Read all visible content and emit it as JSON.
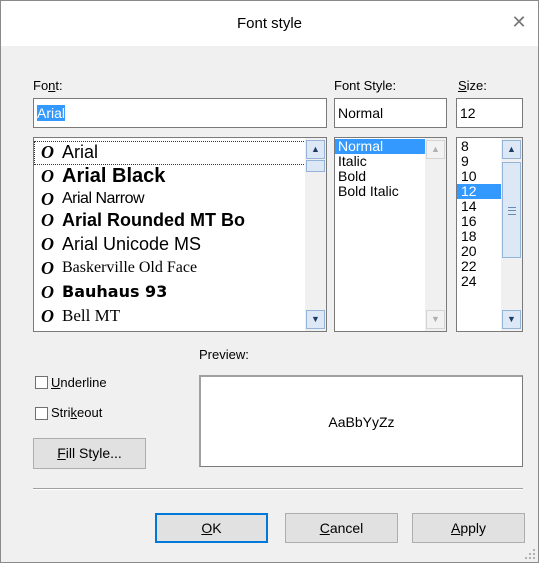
{
  "window": {
    "title": "Font style",
    "close_label": "✕"
  },
  "labels": {
    "font_pre": "Fo",
    "font_u": "n",
    "font_post": "t:",
    "style": "Font Style:",
    "size_u": "S",
    "size_post": "ize:",
    "preview": "Preview:"
  },
  "inputs": {
    "font": "Arial",
    "style": "Normal",
    "size": "12"
  },
  "font_list": [
    "Arial",
    "Arial Black",
    "Arial Narrow",
    "Arial Rounded MT Bo",
    "Arial Unicode MS",
    "Baskerville Old Face",
    "Bauhaus 93",
    "Bell MT"
  ],
  "font_icon_glyph": "O",
  "style_list": [
    "Normal",
    "Italic",
    "Bold",
    "Bold Italic"
  ],
  "size_list": [
    "8",
    "9",
    "10",
    "12",
    "14",
    "16",
    "18",
    "20",
    "22",
    "24"
  ],
  "options": {
    "underline_u": "U",
    "underline_post": "nderline",
    "strike_pre": "Stri",
    "strike_u": "k",
    "strike_post": "eout",
    "fill_u": "F",
    "fill_post": "ill Style..."
  },
  "preview_text": "AaBbYyZz",
  "buttons": {
    "ok_u": "O",
    "ok_post": "K",
    "cancel_u": "C",
    "cancel_post": "ancel",
    "apply_u": "A",
    "apply_post": "pply"
  },
  "scroll_glyphs": {
    "up": "▲",
    "down": "▼"
  },
  "colors": {
    "selection": "#3399ff",
    "scroll_accent": "#dce8f6"
  }
}
